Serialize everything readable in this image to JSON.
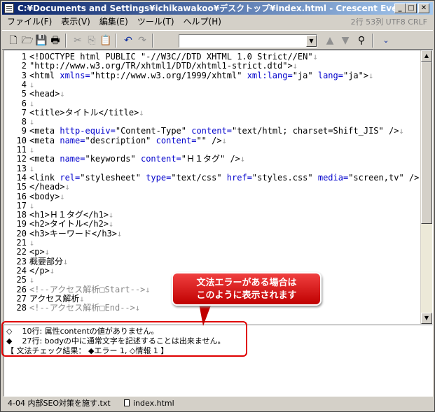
{
  "window": {
    "title": "C:¥Documents and Settings¥ichikawakoo¥デスクトップ¥index.html - Crescent Eve",
    "min": "_",
    "max": "□",
    "close": "✕"
  },
  "menu": {
    "items": [
      "ファイル(F)",
      "表示(V)",
      "編集(E)",
      "ツール(T)",
      "ヘルプ(H)"
    ],
    "status": "2行 53列 UTF8  CRLF"
  },
  "toolbar": {
    "combo_value": ""
  },
  "editor": {
    "lines": [
      {
        "n": "1",
        "html": "&lt;!DOCTYPE html PUBLIC \"-//W3C//DTD XHTML 1.0 Strict//EN\"<span class=\"eol\">↓</span>"
      },
      {
        "n": "2",
        "html": "\"http://www.w3.org/TR/xhtml1/DTD/xhtml1-strict.dtd\"&gt;<span class=\"eol\">↓</span>"
      },
      {
        "n": "3",
        "html": "&lt;html <span class=\"attr\">xmlns=</span>\"http://www.w3.org/1999/xhtml\" <span class=\"attr\">xml:lang=</span>\"ja\" <span class=\"attr\">lang=</span>\"ja\"&gt;<span class=\"eol\">↓</span>"
      },
      {
        "n": "4",
        "html": "<span class=\"eol\">↓</span>"
      },
      {
        "n": "5",
        "html": "&lt;head&gt;<span class=\"eol\">↓</span>"
      },
      {
        "n": "6",
        "html": "<span class=\"eol\">↓</span>"
      },
      {
        "n": "7",
        "html": "&lt;title&gt;タイトル&lt;/title&gt;<span class=\"eol\">↓</span>"
      },
      {
        "n": "8",
        "html": "<span class=\"eol\">↓</span>"
      },
      {
        "n": "9",
        "html": "&lt;meta <span class=\"attr\">http-equiv=</span>\"Content-Type\" <span class=\"attr\">content=</span>\"text/html; charset=Shift_JIS\" /&gt;<span class=\"eol\">↓</span>"
      },
      {
        "n": "10",
        "html": "&lt;meta <span class=\"attr\">name=</span>\"description\" <span class=\"attr\">content=</span>\"\" /&gt;<span class=\"eol\">↓</span>"
      },
      {
        "n": "11",
        "html": "<span class=\"eol\">↓</span>"
      },
      {
        "n": "12",
        "html": "&lt;meta <span class=\"attr\">name=</span>\"keywords\" <span class=\"attr\">content=</span>\"Ｈ１タグ\" /&gt;<span class=\"eol\">↓</span>"
      },
      {
        "n": "13",
        "html": "<span class=\"eol\">↓</span>"
      },
      {
        "n": "14",
        "html": "&lt;link <span class=\"attr\">rel=</span>\"stylesheet\" <span class=\"attr\">type=</span>\"text/css\" <span class=\"attr\">href=</span>\"styles.css\" <span class=\"attr\">media=</span>\"screen,tv\" /&gt;<span class=\"eol\">↓</span>"
      },
      {
        "n": "15",
        "html": "&lt;/head&gt;<span class=\"eol\">↓</span>"
      },
      {
        "n": "16",
        "html": "&lt;body&gt;<span class=\"eol\">↓</span>"
      },
      {
        "n": "17",
        "html": "<span class=\"eol\">↓</span>"
      },
      {
        "n": "18",
        "html": "&lt;h1&gt;Ｈ１タグ&lt;/h1&gt;<span class=\"eol\">↓</span>"
      },
      {
        "n": "19",
        "html": "&lt;h2&gt;タイトル&lt;/h2&gt;<span class=\"eol\">↓</span>"
      },
      {
        "n": "20",
        "html": "&lt;h3&gt;キーワード&lt;/h3&gt;<span class=\"eol\">↓</span>"
      },
      {
        "n": "21",
        "html": "<span class=\"eol\">↓</span>"
      },
      {
        "n": "22",
        "html": "&lt;p&gt;<span class=\"eol\">↓</span>"
      },
      {
        "n": "23",
        "html": "概要部分<span class=\"eol\">↓</span>"
      },
      {
        "n": "24",
        "html": "&lt;/p&gt;<span class=\"eol\">↓</span>"
      },
      {
        "n": "25",
        "html": "<span class=\"eol\">↓</span>"
      },
      {
        "n": "26",
        "html": "<span class=\"cmt\">&lt;!--アクセス解析□Start--&gt;</span><span class=\"eol\">↓</span>"
      },
      {
        "n": "27",
        "html": "アクセス解析<span class=\"eol\">↓</span>"
      },
      {
        "n": "28",
        "html": "<span class=\"cmt\">&lt;!--アクセス解析□End--&gt;</span><span class=\"eol\">↓</span>"
      }
    ]
  },
  "output": {
    "lines": [
      "◇    10行: 属性contentの値がありません。",
      "◆    27行: bodyの中に通常文字を記述することは出来ません。",
      "【 文法チェック結果： ◆エラー 1, ◇情報 1 】"
    ]
  },
  "callout": {
    "line1": "文法エラーがある場合は",
    "line2": "このように表示されます"
  },
  "statusbar": {
    "left": "4-04 内部SEO対策を施す.txt",
    "right": "index.html"
  }
}
